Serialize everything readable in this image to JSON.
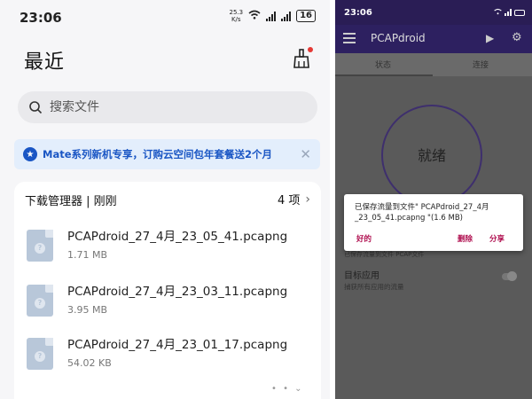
{
  "left": {
    "status_bar": {
      "time": "23:06",
      "net_speed_value": "25.3",
      "net_speed_unit": "K/s",
      "battery": "16"
    },
    "title": "最近",
    "search": {
      "placeholder": "搜索文件"
    },
    "banner": {
      "text": "Mate系列新机专享，订购云空间包年套餐送2个月"
    },
    "downloads": {
      "header": "下载管理器 | 刚刚",
      "count": "4 项",
      "files": [
        {
          "name": "PCAPdroid_27_4月_23_05_41.pcapng",
          "size": "1.71 MB"
        },
        {
          "name": "PCAPdroid_27_4月_23_03_11.pcapng",
          "size": "3.95 MB"
        },
        {
          "name": "PCAPdroid_27_4月_23_01_17.pcapng",
          "size": "54.02 KB"
        }
      ]
    }
  },
  "right": {
    "status_bar": {
      "time": "23:06"
    },
    "app_name": "PCAPdroid",
    "tabs": [
      "状态",
      "连接"
    ],
    "status_text": "就绪",
    "dialog": {
      "message": "已保存流量到文件\" PCAPdroid_27_4月_23_05_41.pcapng \"(1.6 MB)",
      "ok": "好的",
      "delete": "删除",
      "share": "分享"
    },
    "faded_line": "已保存流量到文件    PCAP文件",
    "target_app": {
      "title": "目标应用",
      "subtitle": "捕获所有应用的流量"
    }
  },
  "colors": {
    "accent_blue": "#1a56c4",
    "toolbar_purple": "#2d2060",
    "dialog_button": "#b01050",
    "notification_dot": "#e53935"
  }
}
